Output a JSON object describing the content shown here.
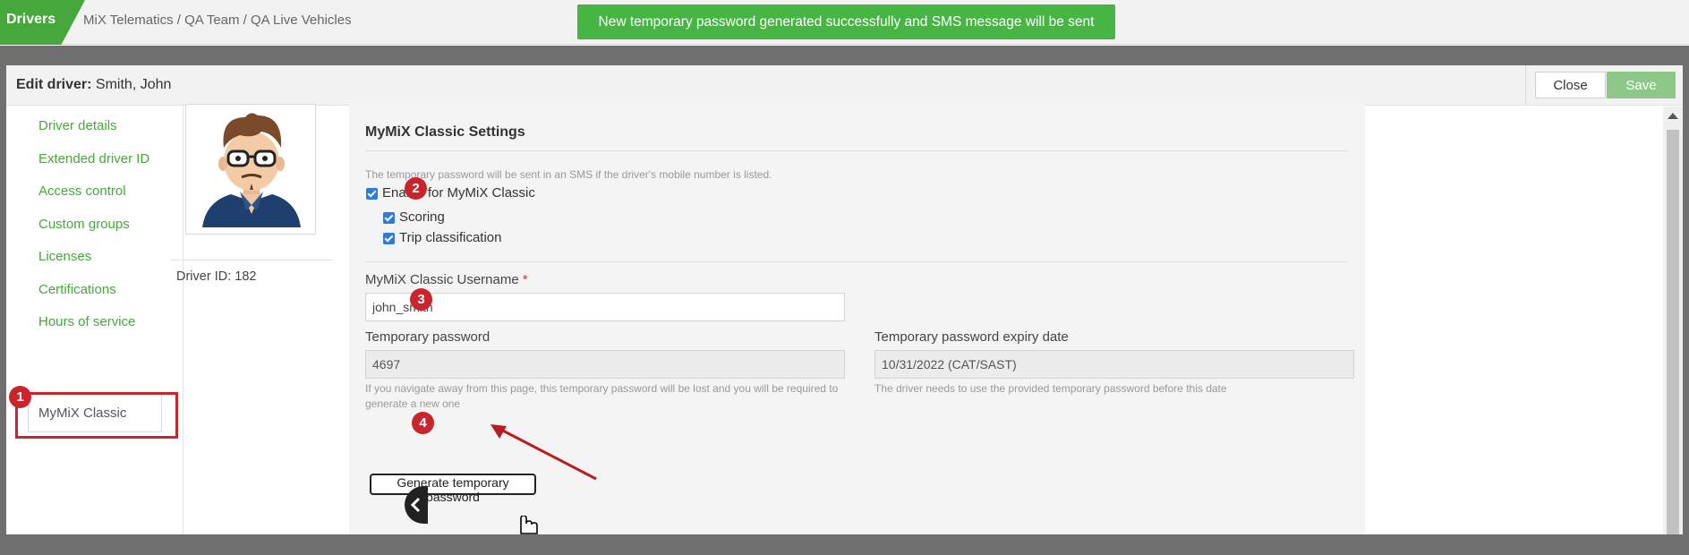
{
  "topbar": {
    "module_tab": "Drivers",
    "breadcrumb": "MiX Telematics / QA Team / QA Live Vehicles",
    "toast": "New temporary password generated successfully and SMS message will be sent"
  },
  "modal": {
    "title_prefix": "Edit driver:",
    "title_name": "Smith, John",
    "close_label": "Close",
    "save_label": "Save"
  },
  "sidebar": {
    "items": [
      {
        "label": "Driver details"
      },
      {
        "label": "Extended driver ID"
      },
      {
        "label": "Access control"
      },
      {
        "label": "Custom groups"
      },
      {
        "label": "Licenses"
      },
      {
        "label": "Certifications"
      },
      {
        "label": "Hours of service"
      },
      {
        "label": "MyMiX Classic"
      }
    ],
    "active": "MyMiX Classic"
  },
  "profile": {
    "driver_id": "Driver ID: 182"
  },
  "settings": {
    "title": "MyMiX Classic Settings",
    "sms_hint": "The temporary password will be sent in an SMS if the driver's mobile number is listed.",
    "enable_label": "Enable for MyMiX Classic",
    "enable_checked": true,
    "scoring_label": "Scoring",
    "scoring_checked": true,
    "trip_label": "Trip classification",
    "trip_checked": true,
    "username_label": "MyMiX Classic Username",
    "required_mark": "*",
    "username_value": "john_smith",
    "temp_password_label": "Temporary password",
    "temp_password_value": "4697",
    "temp_password_hint": "If you navigate away from this page, this temporary password will be lost and you will be required to generate a new one",
    "expiry_label": "Temporary password expiry date",
    "expiry_value": "10/31/2022 (CAT/SAST)",
    "expiry_hint": "The driver needs to use the provided temporary password before this date",
    "generate_label": "Generate temporary password"
  },
  "annotations": {
    "steps": [
      "1",
      "2",
      "3",
      "4"
    ]
  },
  "colors": {
    "brand_green": "#46a83a",
    "toast_green": "#46b544",
    "annotation_red": "#c9252c",
    "checkbox_blue": "#2f7bd9"
  }
}
